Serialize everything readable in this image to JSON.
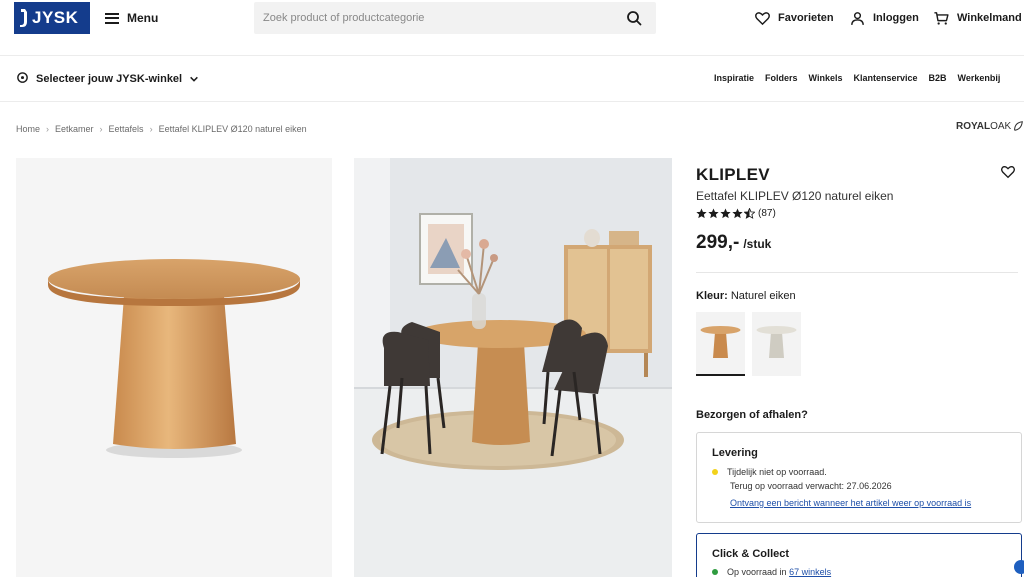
{
  "header": {
    "logo_text": "JYSK",
    "menu_label": "Menu",
    "search_placeholder": "Zoek product of productcategorie",
    "favorites_label": "Favorieten",
    "login_label": "Inloggen",
    "cart_label": "Winkelmand",
    "brand_color": "#143c8c"
  },
  "subheader": {
    "store_select_label": "Selecteer jouw JYSK-winkel",
    "nav": [
      "Inspiratie",
      "Folders",
      "Winkels",
      "Klantenservice",
      "B2B",
      "Werkenbij"
    ]
  },
  "breadcrumb": [
    "Home",
    "Eetkamer",
    "Eettafels",
    "Eettafel KLIPLEV Ø120 naturel eiken"
  ],
  "brand_logo": {
    "part1": "ROYAL",
    "part2": "OAK"
  },
  "product": {
    "name": "KLIPLEV",
    "subtitle": "Eettafel KLIPLEV Ø120 naturel eiken",
    "rating": 4.5,
    "review_count": "(87)",
    "price": "299,-",
    "price_unit": "/stuk",
    "color_label": "Kleur:",
    "color_value": "Naturel eiken",
    "swatches": [
      {
        "name": "naturel-eiken",
        "color": "#c9935a",
        "selected": true
      },
      {
        "name": "wit",
        "color": "#d9d6cc",
        "selected": false
      }
    ]
  },
  "delivery": {
    "question": "Bezorgen of afhalen?",
    "levering_title": "Levering",
    "levering_status": "Tijdelijk niet op voorraad.",
    "levering_back": "Terug op voorraad verwacht: 27.06.2026",
    "notify_link": "Ontvang een bericht wanneer het artikel weer op voorraad is",
    "status_yellow": "#f2d21b",
    "cc_title": "Click & Collect",
    "cc_status_prefix": "Op voorraad in",
    "cc_stores_link": "67 winkels",
    "status_green": "#2e9b3f"
  }
}
